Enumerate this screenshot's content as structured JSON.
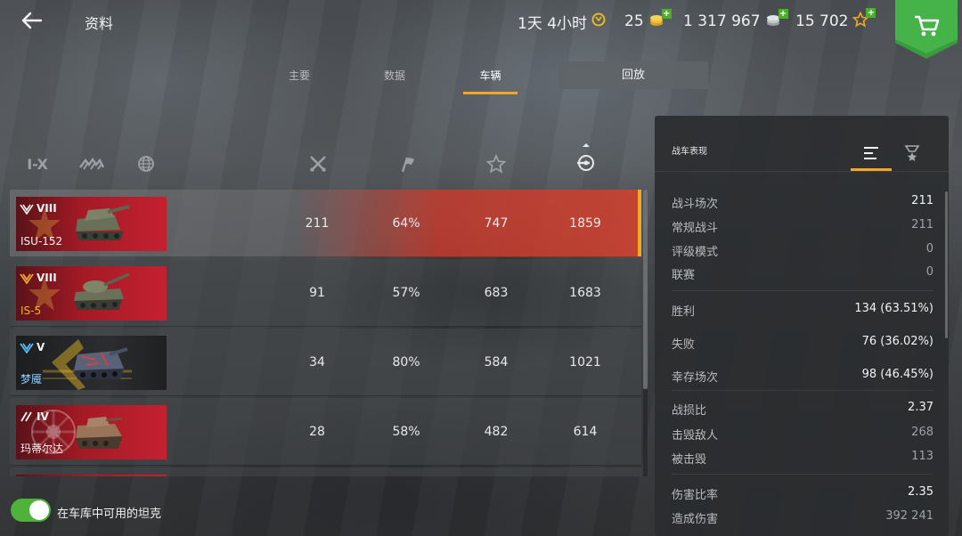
{
  "header": {
    "title": "资料",
    "timer": "1天 4小时",
    "gold": "25",
    "silver": "1 317 967",
    "free_xp": "15 702"
  },
  "tabs": [
    {
      "label": "主要"
    },
    {
      "label": "数据"
    },
    {
      "label": "车辆"
    }
  ],
  "replay_label": "回放",
  "filters": {
    "tier_label": "I-X"
  },
  "vehicles": [
    {
      "tier": "VIII",
      "name": "ISU-152",
      "battles": "211",
      "winrate": "64%",
      "xp": "747",
      "damage": "1859"
    },
    {
      "tier": "VIII",
      "name": "IS-5",
      "battles": "91",
      "winrate": "57%",
      "xp": "683",
      "damage": "1683"
    },
    {
      "tier": "V",
      "name": "梦魇",
      "battles": "34",
      "winrate": "80%",
      "xp": "584",
      "damage": "1021"
    },
    {
      "tier": "IV",
      "name": "玛蒂尔达",
      "battles": "28",
      "winrate": "58%",
      "xp": "482",
      "damage": "614"
    }
  ],
  "toggle": {
    "label": "在车库中可用的坦克",
    "on": true
  },
  "panel": {
    "title": "战车表现",
    "stats": [
      {
        "label": "战斗场次",
        "value": "211"
      },
      {
        "label": "常规战斗",
        "value": "211"
      },
      {
        "label": "评级模式",
        "value": "0"
      },
      {
        "label": "联赛",
        "value": "0"
      },
      {
        "label": "胜利",
        "value": "134 (63.51%)"
      },
      {
        "label": "失败",
        "value": "76 (36.02%)"
      },
      {
        "label": "幸存场次",
        "value": "98 (46.45%)"
      },
      {
        "label": "战损比",
        "value": "2.37"
      },
      {
        "label": "击毁敌人",
        "value": "268"
      },
      {
        "label": "被击毁",
        "value": "113"
      },
      {
        "label": "伤害比率",
        "value": "2.35"
      },
      {
        "label": "造成伤害",
        "value": "392 241"
      }
    ]
  },
  "colors": {
    "accent": "#f5a623",
    "toggle_on": "#4fb33b",
    "card_red": "#c42130",
    "shop_green": "#3a9a3e"
  }
}
